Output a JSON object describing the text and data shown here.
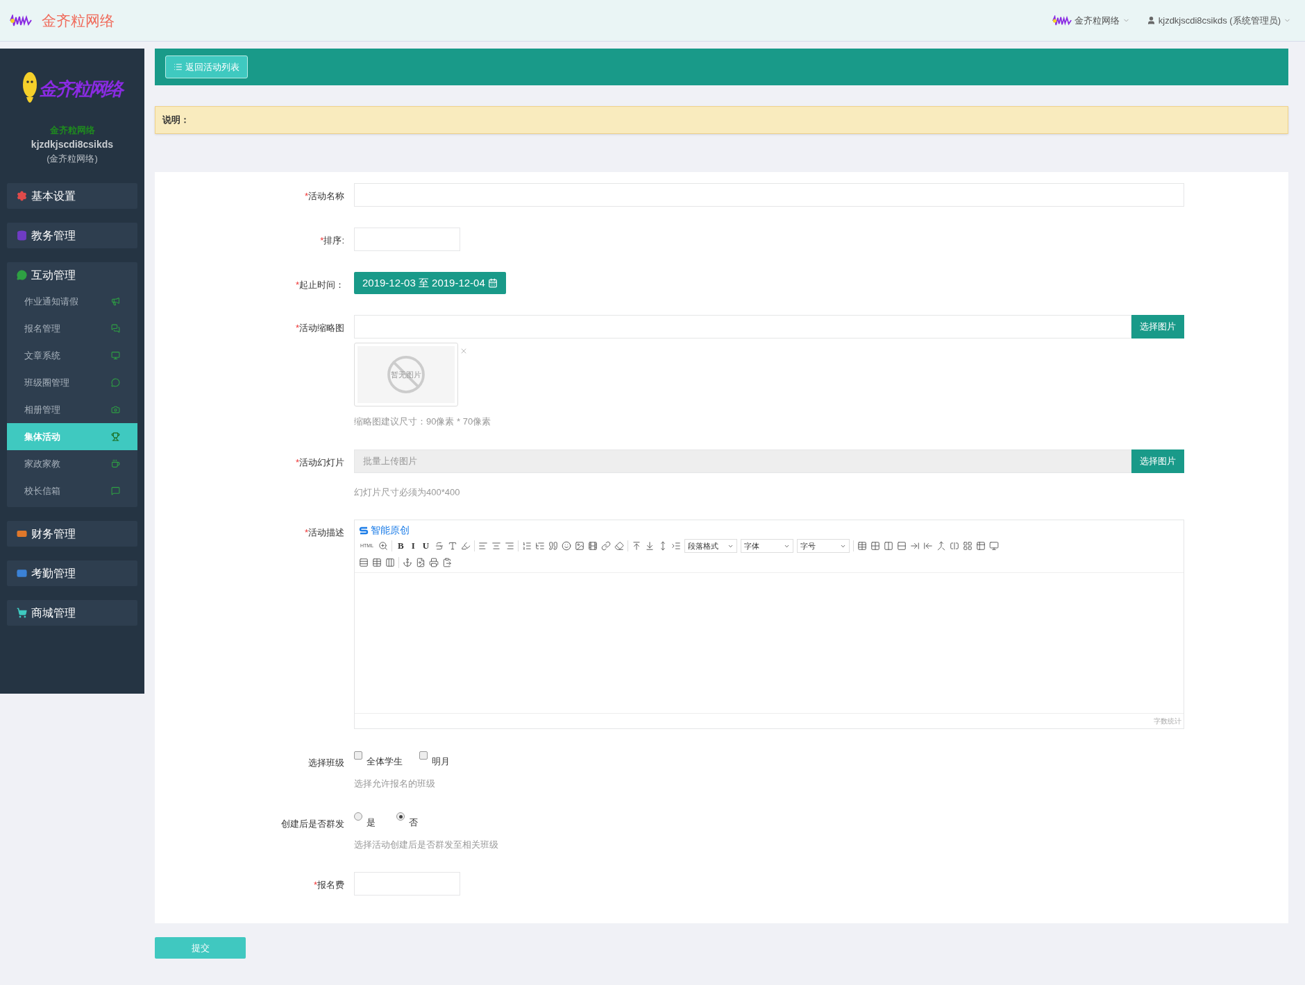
{
  "topbar": {
    "brand": "金齐粒网络",
    "org_menu": "金齐粒网络",
    "user_menu": "kjzdkjscdi8csikds (系统管理员)"
  },
  "sidebar": {
    "logo_text": "金齐粒网络",
    "org": "金齐粒网络",
    "username": "kjzdkjscdi8csikds",
    "org_note": "(金齐粒网络)",
    "groups": [
      {
        "label": "基本设置",
        "color": "#e04b4b"
      },
      {
        "label": "教务管理",
        "color": "#6f3cc3"
      },
      {
        "label": "互动管理",
        "color": "#2ea043",
        "children": [
          {
            "label": "作业通知请假",
            "selected": false
          },
          {
            "label": "报名管理",
            "selected": false
          },
          {
            "label": "文章系统",
            "selected": false
          },
          {
            "label": "班级圈管理",
            "selected": false
          },
          {
            "label": "相册管理",
            "selected": false
          },
          {
            "label": "集体活动",
            "selected": true
          },
          {
            "label": "家政家教",
            "selected": false
          },
          {
            "label": "校长信箱",
            "selected": false
          }
        ]
      },
      {
        "label": "财务管理",
        "color": "#e0782b"
      },
      {
        "label": "考勤管理",
        "color": "#3b82d6"
      },
      {
        "label": "商城管理",
        "color": "#3fc9c0"
      }
    ]
  },
  "header": {
    "back_button": "返回活动列表"
  },
  "notice": {
    "label": "说明："
  },
  "form": {
    "name_label": {
      "mark": "*",
      "text": "活动名称"
    },
    "sort_label": {
      "mark": "*",
      "text": "排序:"
    },
    "date_label": {
      "mark": "*",
      "text": "起止时间："
    },
    "date_range": "2019-12-03 至 2019-12-04",
    "thumb_label": {
      "mark": "*",
      "text": "活动缩略图"
    },
    "thumb_button": "选择图片",
    "thumb_empty": "暂无图片",
    "thumb_hint": "缩略图建议尺寸：90像素 * 70像素",
    "slides_label": {
      "mark": "*",
      "text": "活动幻灯片"
    },
    "slides_placeholder": "批量上传图片",
    "slides_button": "选择图片",
    "slides_hint": "幻灯片尺寸必须为400*400",
    "desc_label": {
      "mark": "*",
      "text": "活动描述"
    },
    "editor": {
      "brand": "智能原创",
      "word_count": "字数统计",
      "row1": [
        {
          "kind": "text",
          "label": "HTML"
        },
        {
          "kind": "icon"
        },
        {
          "kind": "sep"
        },
        {
          "kind": "text",
          "label": "B"
        },
        {
          "kind": "text",
          "label": "I"
        },
        {
          "kind": "text",
          "label": "U"
        },
        {
          "kind": "icon"
        },
        {
          "kind": "icon"
        },
        {
          "kind": "icon"
        },
        {
          "kind": "sep"
        },
        {
          "kind": "icon"
        },
        {
          "kind": "icon"
        },
        {
          "kind": "icon"
        },
        {
          "kind": "sep"
        },
        {
          "kind": "icon"
        },
        {
          "kind": "icon"
        },
        {
          "kind": "icon"
        },
        {
          "kind": "icon"
        },
        {
          "kind": "icon"
        },
        {
          "kind": "icon"
        },
        {
          "kind": "icon"
        },
        {
          "kind": "icon"
        },
        {
          "kind": "sep"
        },
        {
          "kind": "icon"
        },
        {
          "kind": "icon"
        },
        {
          "kind": "icon"
        },
        {
          "kind": "icon"
        },
        {
          "kind": "select",
          "label": "段落格式"
        },
        {
          "kind": "select",
          "label": "字体"
        },
        {
          "kind": "select",
          "label": "字号"
        },
        {
          "kind": "sep"
        },
        {
          "kind": "icon"
        },
        {
          "kind": "icon"
        },
        {
          "kind": "icon"
        },
        {
          "kind": "icon"
        },
        {
          "kind": "icon"
        },
        {
          "kind": "icon"
        },
        {
          "kind": "icon"
        },
        {
          "kind": "icon"
        },
        {
          "kind": "icon"
        },
        {
          "kind": "icon"
        },
        {
          "kind": "icon"
        }
      ],
      "row2": [
        {
          "kind": "icon"
        },
        {
          "kind": "icon"
        },
        {
          "kind": "icon"
        },
        {
          "kind": "sep"
        },
        {
          "kind": "icon"
        },
        {
          "kind": "icon"
        },
        {
          "kind": "icon"
        },
        {
          "kind": "icon"
        }
      ]
    },
    "class_label": "选择班级",
    "classes": [
      {
        "label": "全体学生",
        "checked": false
      },
      {
        "label": "明月",
        "checked": false
      }
    ],
    "class_hint": "选择允许报名的班级",
    "broadcast_label": "创建后是否群发",
    "broadcast_options": [
      {
        "label": "是",
        "selected": false
      },
      {
        "label": "否",
        "selected": true
      }
    ],
    "broadcast_hint": "选择活动创建后是否群发至相关班级",
    "fee_label": {
      "mark": "*",
      "text": "报名费"
    }
  },
  "submit": "提交"
}
